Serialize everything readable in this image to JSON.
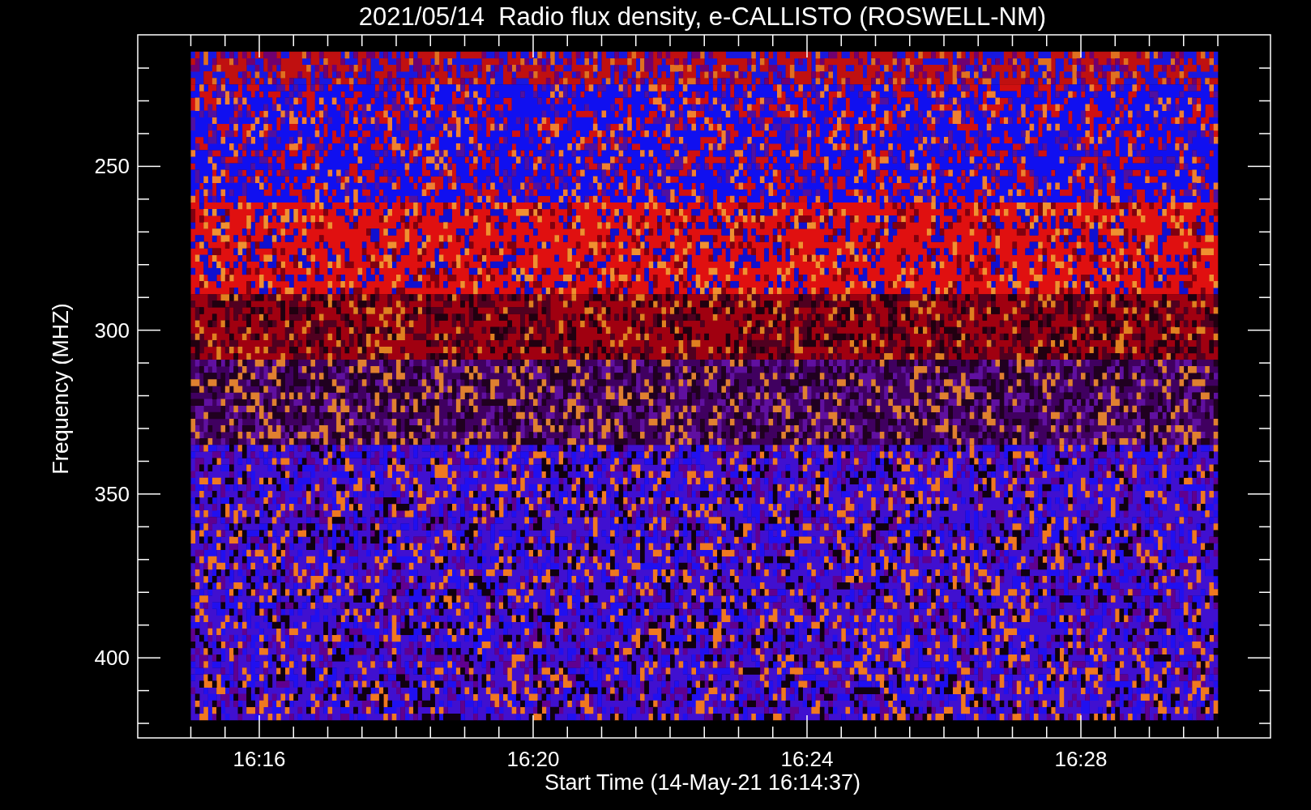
{
  "title": "2021/05/14  Radio flux density, e-CALLISTO (ROSWELL-NM)",
  "y_axis": {
    "label": "Frequency (MHZ)",
    "ticks": [
      "250",
      "300",
      "350",
      "400"
    ]
  },
  "x_axis": {
    "label": "Start Time (14-May-21 16:14:37)",
    "ticks": [
      "16:16",
      "16:20",
      "16:24",
      "16:28"
    ]
  }
}
